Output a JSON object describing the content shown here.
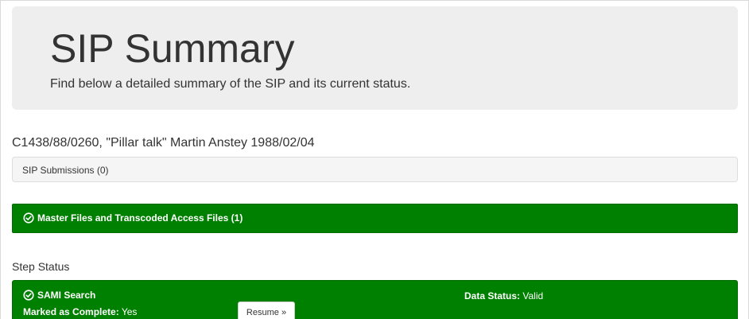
{
  "header": {
    "title": "SIP Summary",
    "subtitle": "Find below a detailed summary of the SIP and its current status."
  },
  "sip": {
    "title": "C1438/88/0260, \"Pillar talk\" Martin Anstey 1988/02/04",
    "submissions_label": "SIP Submissions (0)"
  },
  "master_files": {
    "label": "Master Files and Transcoded Access Files (1)",
    "icon": "check-circle-icon"
  },
  "step_status": {
    "heading": "Step Status",
    "steps": [
      {
        "name": "SAMI Search",
        "icon": "check-circle-icon",
        "complete_label": "Marked as Complete:",
        "complete_value": "Yes",
        "data_status_label": "Data Status:",
        "data_status_value": "Valid",
        "resume_label": "Resume »"
      }
    ]
  },
  "colors": {
    "panel_success": "#008000",
    "jumbotron_bg": "#eeeeee",
    "text": "#333333"
  }
}
